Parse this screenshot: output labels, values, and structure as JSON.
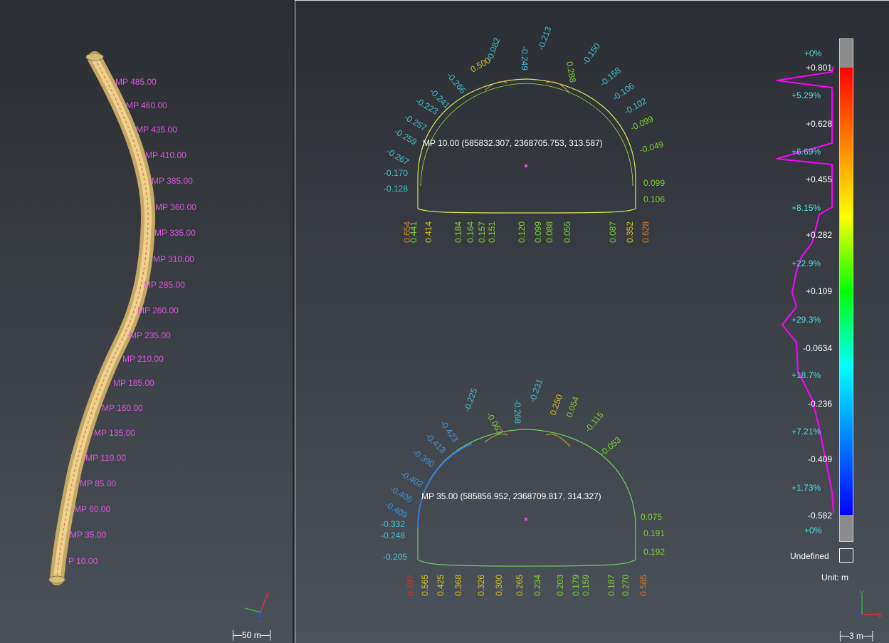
{
  "left_view": {
    "mileposts": [
      "MP 485.00",
      "MP 460.00",
      "MP 435.00",
      "MP 410.00",
      "MP 385.00",
      "MP 360.00",
      "MP 335.00",
      "MP 310.00",
      "MP 285.00",
      "MP 260.00",
      "MP 235.00",
      "MP 210.00",
      "MP 185.00",
      "MP 160.00",
      "MP 135.00",
      "MP 110.00",
      "MP 85.00",
      "MP 60.00",
      "MP 35.00",
      "P 10.00"
    ],
    "scale_label": "50 m",
    "axes": {
      "x": "X",
      "y": "Y",
      "z": "Z"
    }
  },
  "section1": {
    "title": "MP 10.00 (585832.307, 2368705.753, 313.587)",
    "arch_labels": [
      "-0.267",
      "-0.259",
      "-0.257",
      "-0.223",
      "-0.241",
      "-0.266",
      "0.500",
      "-0.082",
      "-0.249",
      "-0.213",
      "0.288",
      "-0.150",
      "-0.158",
      "-0.106",
      "-0.102",
      "-0.099",
      "-0.049"
    ],
    "left_wall": [
      "-0.170",
      "-0.128"
    ],
    "right_wall": [
      "0.099",
      "0.106"
    ],
    "floor_labels": [
      "0.654",
      "0.441",
      "0.414",
      "0.184",
      "0.164",
      "0.157",
      "0.151",
      "0.120",
      "0.099",
      "0.088",
      "0.055",
      "0.087",
      "0.352",
      "0.628"
    ]
  },
  "section2": {
    "title": "MP 35.00 (585856.952, 2368709.817, 314.327)",
    "arch_labels": [
      "-0.409",
      "-0.406",
      "-0.402",
      "-0.390",
      "-0.413",
      "-0.423",
      "-0.225",
      "-0.063",
      "-0.268",
      "-0.231",
      "0.250",
      "0.054",
      "-0.115",
      "-0.053"
    ],
    "left_wall": [
      "-0.332",
      "-0.248",
      "-0.205"
    ],
    "right_wall": [
      "0.075",
      "0.191",
      "0.192"
    ],
    "floor_labels": [
      "0.597",
      "0.565",
      "0.425",
      "0.368",
      "0.326",
      "0.300",
      "0.265",
      "0.234",
      "0.203",
      "0.179",
      "0.159",
      "0.187",
      "0.270",
      "0.585"
    ]
  },
  "legend": {
    "values": [
      "+0.801",
      "+0.628",
      "+0.455",
      "+0.282",
      "+0.109",
      "-0.0634",
      "-0.236",
      "-0.409",
      "-0.582"
    ],
    "percents": [
      "+0%",
      "+5.29%",
      "+6.69%",
      "+8.15%",
      "+22.9%",
      "+29.3%",
      "+18.7%",
      "+7.21%",
      "+1.73%",
      "+0%"
    ],
    "undefined_label": "Undefined",
    "unit_label": "Unit: m"
  },
  "right_view": {
    "scale_label": "3 m",
    "axes": {
      "y": "Y",
      "z": "Z",
      "x": "X"
    }
  },
  "colors": {
    "milepost": "#d957d9",
    "histogram": "#ff00ff",
    "cyan": "#4fe0e0"
  }
}
